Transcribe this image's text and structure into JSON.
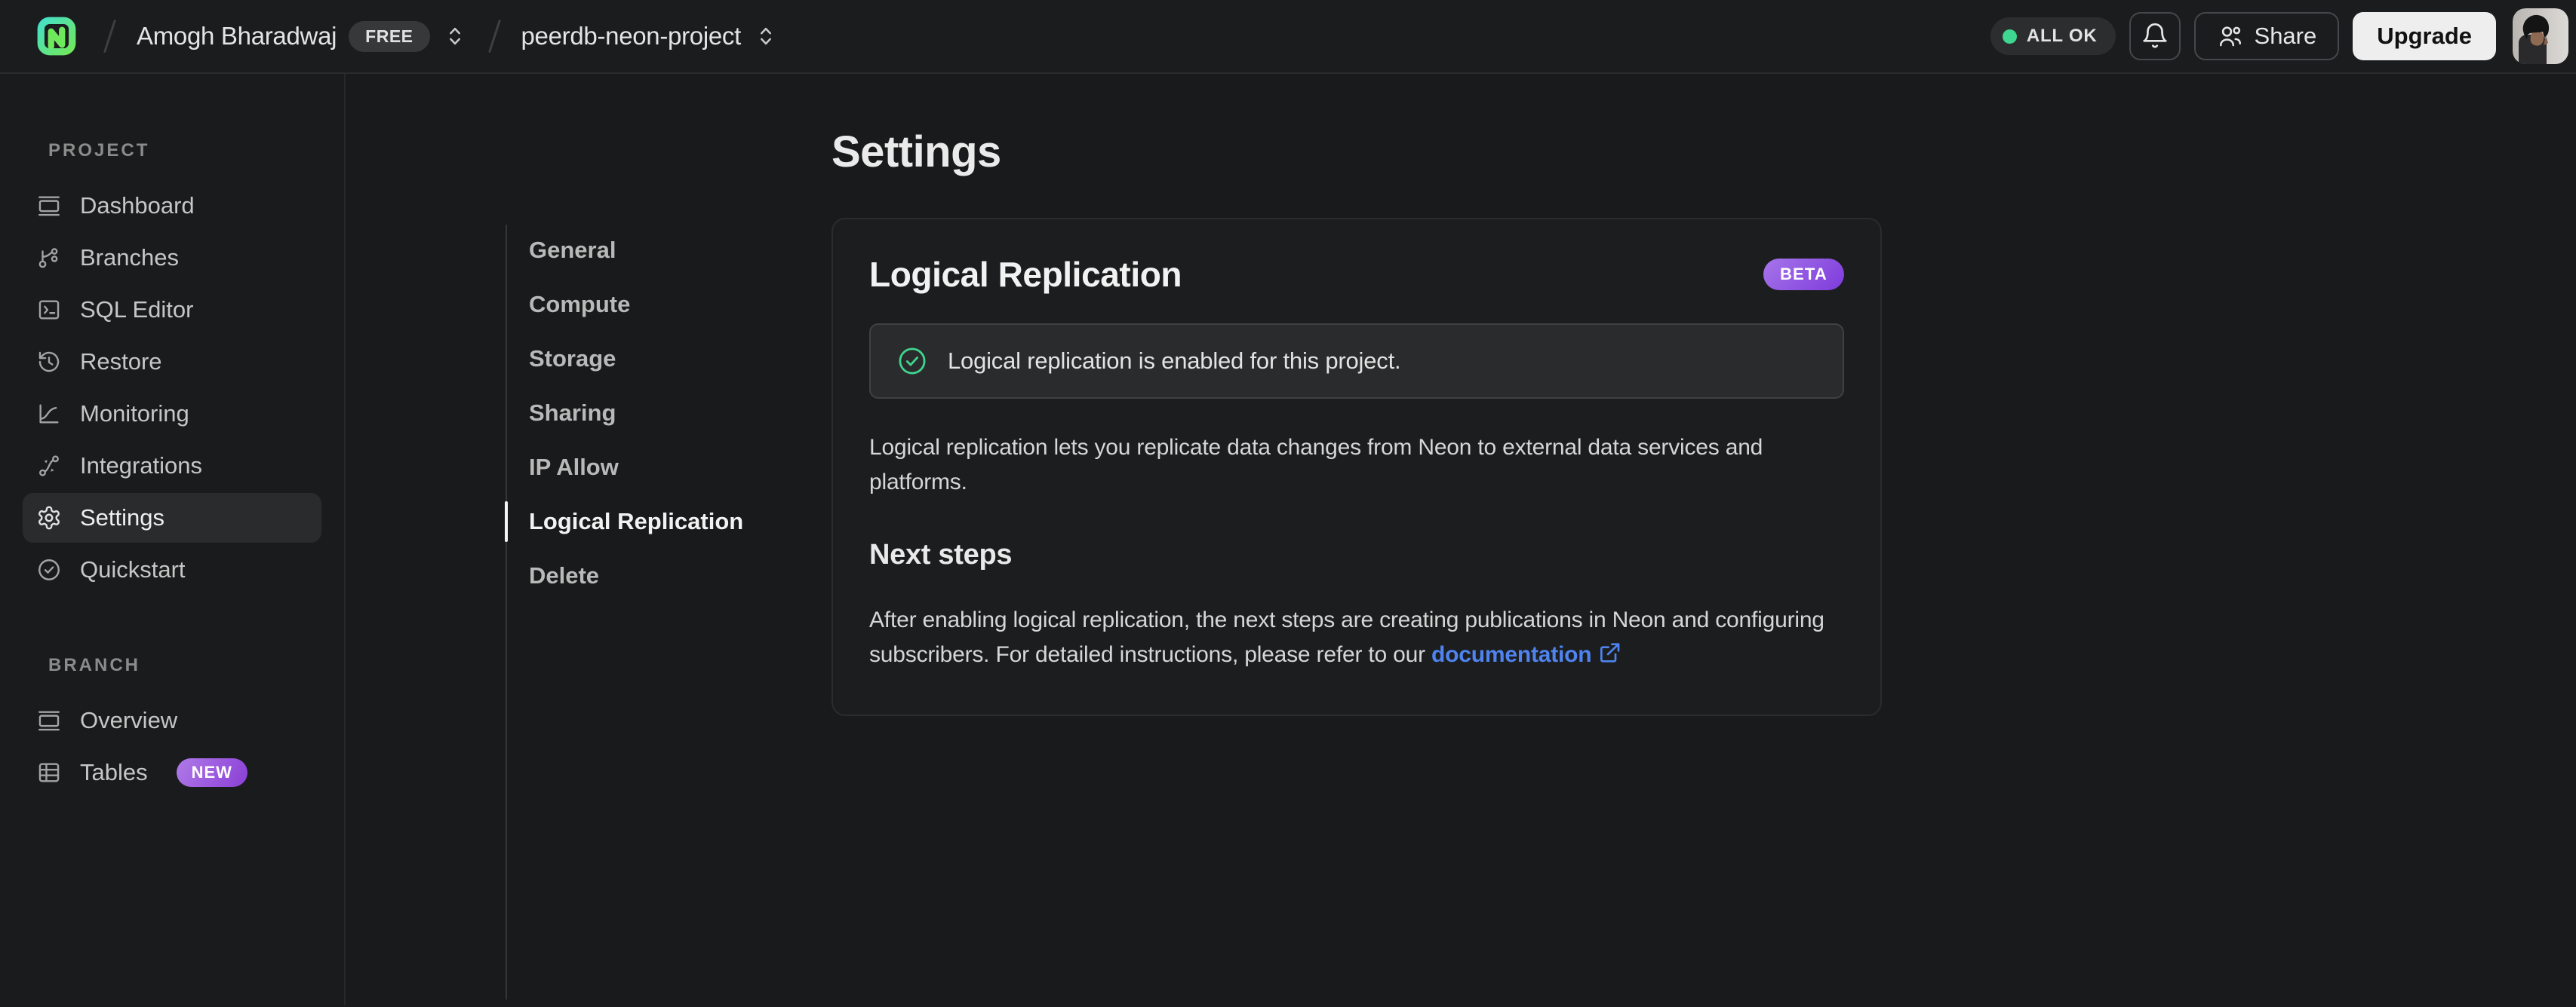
{
  "header": {
    "org_name": "Amogh Bharadwaj",
    "plan_badge": "FREE",
    "project_name": "peerdb-neon-project",
    "status_label": "ALL OK",
    "share_label": "Share",
    "upgrade_label": "Upgrade"
  },
  "sidebar": {
    "project_label": "PROJECT",
    "project_items": [
      {
        "label": "Dashboard"
      },
      {
        "label": "Branches"
      },
      {
        "label": "SQL Editor"
      },
      {
        "label": "Restore"
      },
      {
        "label": "Monitoring"
      },
      {
        "label": "Integrations"
      },
      {
        "label": "Settings"
      },
      {
        "label": "Quickstart"
      }
    ],
    "branch_label": "BRANCH",
    "branch_items": [
      {
        "label": "Overview"
      },
      {
        "label": "Tables",
        "badge": "NEW"
      }
    ]
  },
  "subnav": {
    "items": [
      {
        "label": "General"
      },
      {
        "label": "Compute"
      },
      {
        "label": "Storage"
      },
      {
        "label": "Sharing"
      },
      {
        "label": "IP Allow"
      },
      {
        "label": "Logical Replication"
      },
      {
        "label": "Delete"
      }
    ],
    "active": "Logical Replication"
  },
  "main": {
    "title": "Settings",
    "card": {
      "heading": "Logical Replication",
      "beta_badge": "BETA",
      "banner_text": "Logical replication is enabled for this project.",
      "description": "Logical replication lets you replicate data changes from Neon to external data services and platforms.",
      "next_steps_title": "Next steps",
      "next_steps_text": "After enabling logical replication, the next steps are creating publications in Neon and configuring subscribers. For detailed instructions, please refer to our ",
      "link_text": "documentation"
    }
  },
  "colors": {
    "brand_gradient_start": "#45e0b8",
    "brand_gradient_end": "#71e75a",
    "status_green": "#3fd68f",
    "badge_purple_start": "#a675ea",
    "badge_purple_end": "#7e3bdb",
    "link_blue": "#4f83ef"
  }
}
